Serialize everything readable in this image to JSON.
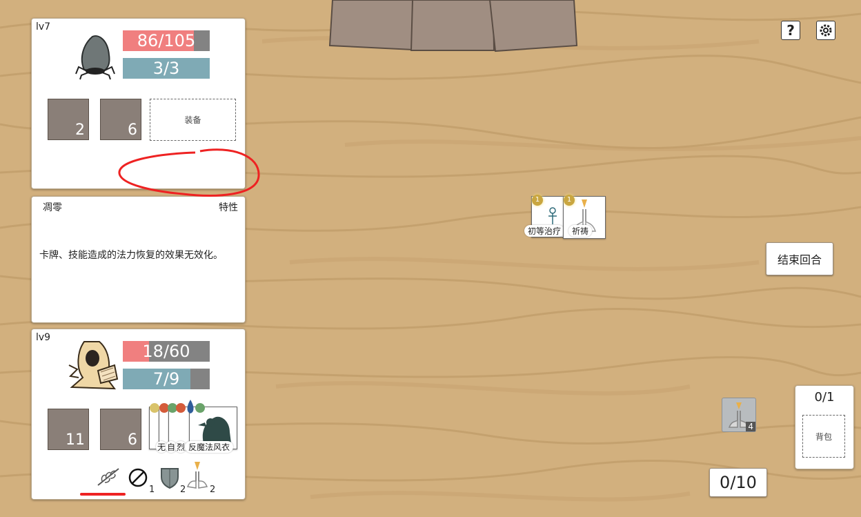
{
  "colors": {
    "hp_fill": "#f07f7f",
    "mp_fill": "#7faab5",
    "bar_empty": "#838383",
    "stat_box": "#8a7f78",
    "table": "#d2b07e",
    "annotation": "#ee2222"
  },
  "enemy": {
    "level": "lv7",
    "portrait_icon": "spider-rock-monster-icon",
    "hp_text": "86/105",
    "hp_fraction": 0.82,
    "mp_text": "3/3",
    "mp_fraction": 1.0,
    "stat_a": "2",
    "stat_b": "6",
    "equip_label": "装备"
  },
  "trait": {
    "name": "凋零",
    "tag": "特性",
    "description": "卡牌、技能造成的法力恢复的效果无效化。"
  },
  "player": {
    "level": "lv9",
    "portrait_icon": "hooded-mage-reading-icon",
    "hp_text": "18/60",
    "hp_fraction": 0.3,
    "mp_text": "7/9",
    "mp_fraction": 0.78,
    "stat_a": "11",
    "stat_b": "6",
    "equipped_card_label": "反魔法风衣",
    "partial_card_labels": [
      "无",
      "自",
      "烈"
    ],
    "status_effects": [
      {
        "icon": "withered-branch-icon",
        "count": ""
      },
      {
        "icon": "forbidden-circle-icon",
        "count": "1"
      },
      {
        "icon": "shield-icon",
        "count": "2"
      },
      {
        "icon": "praying-hands-icon",
        "count": "2"
      }
    ]
  },
  "played_cards": [
    {
      "label": "初等治疗",
      "cost": "1",
      "icon": "ankh-icon"
    },
    {
      "label": "祈祷",
      "cost": "1",
      "icon": "praying-hands-icon"
    }
  ],
  "top_bar": {
    "help_glyph": "?",
    "settings_icon": "gear-icon"
  },
  "end_turn_label": "结束回合",
  "backpack": {
    "count": "0/1",
    "label": "背包"
  },
  "deck_pile": {
    "icon": "praying-hands-icon",
    "count": "4"
  },
  "hand_count": "0/10"
}
